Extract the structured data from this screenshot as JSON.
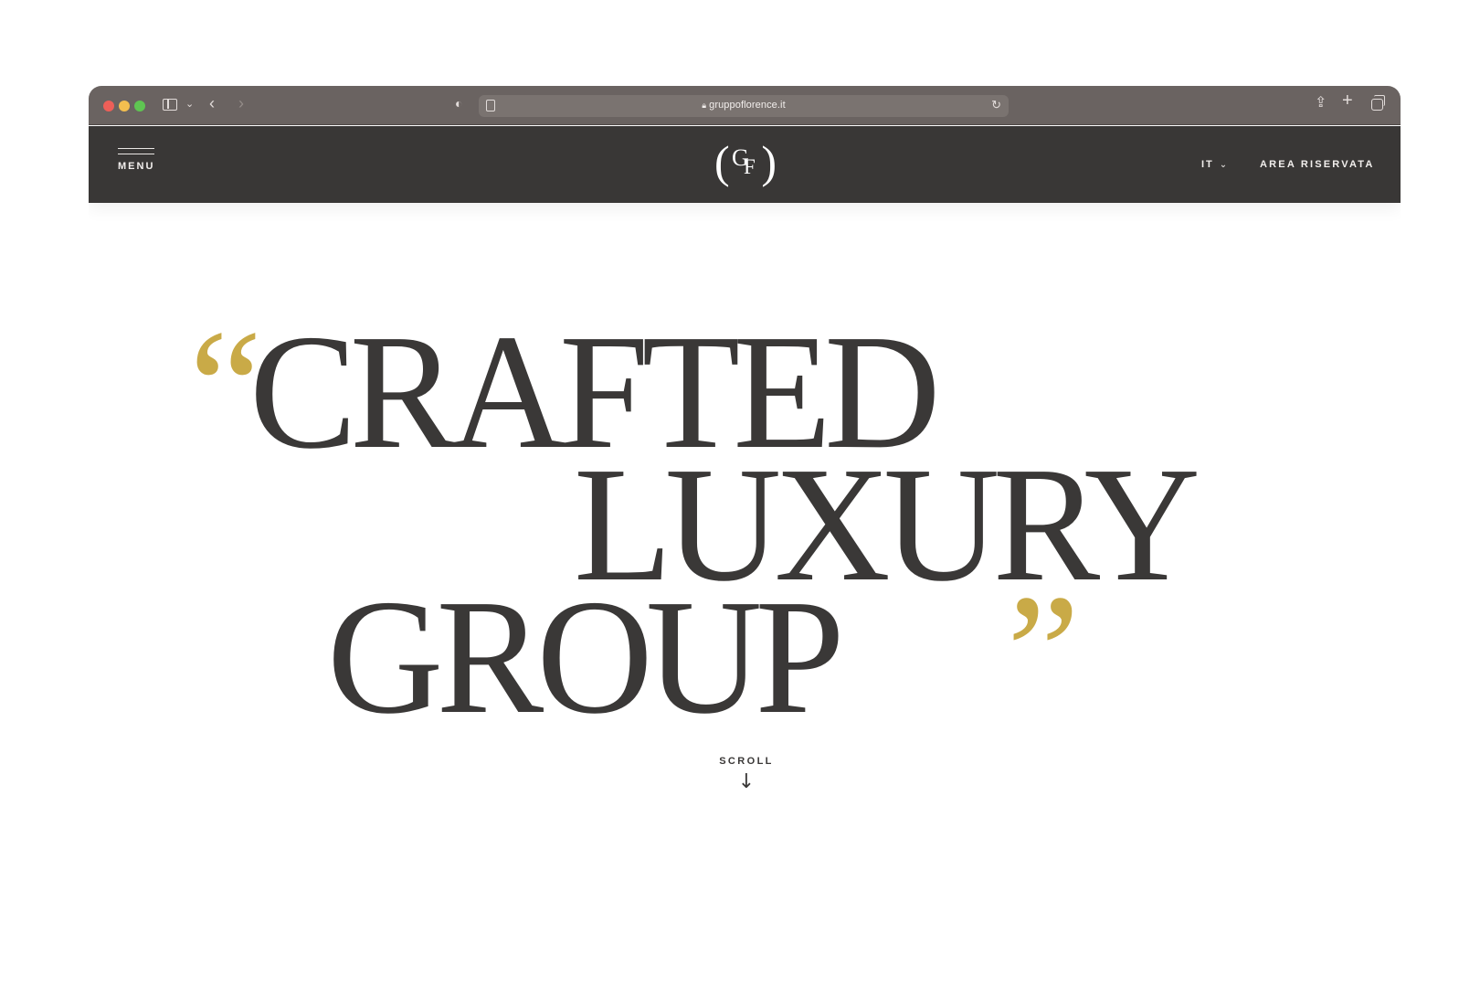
{
  "browser": {
    "url": "gruppoflorence.it",
    "icons": {
      "sidebar": "sidebar-icon",
      "dropdown": "chevron-down-icon",
      "back": "chevron-left-icon",
      "forward": "chevron-right-icon",
      "privacy": "shield-icon",
      "reader": "reader-icon",
      "lock": "lock-icon",
      "reload": "reload-icon",
      "share": "share-icon",
      "new_tab": "plus-icon",
      "tabs": "tabs-overview-icon"
    }
  },
  "header": {
    "menu_label": "MENU",
    "logo": {
      "left_paren": "(",
      "letter_g": "G",
      "letter_f": "F",
      "right_paren": ")"
    },
    "language": "IT",
    "reserved_area": "AREA RISERVATA"
  },
  "hero": {
    "open_quote": "“",
    "line1": "CRAFTED",
    "line2": "LUXURY",
    "line3": "GROUP",
    "close_quote": "”"
  },
  "scroll": {
    "label": "SCROLL",
    "arrow": "↓"
  },
  "colors": {
    "header_bg": "#393736",
    "text_dark": "#3a3837",
    "accent_gold": "#c9aa47",
    "browser_bar": "#6a6361"
  }
}
